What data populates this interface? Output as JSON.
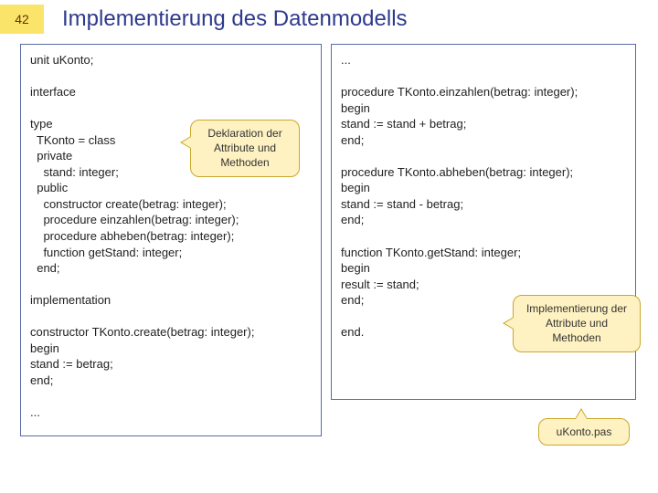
{
  "slide_number": "42",
  "title": "Implementierung des Datenmodells",
  "left_code": [
    "unit uKonto;",
    "",
    "interface",
    "",
    "type",
    "  TKonto = class",
    "  private",
    "    stand: integer;",
    "  public",
    "    constructor create(betrag: integer);",
    "    procedure einzahlen(betrag: integer);",
    "    procedure abheben(betrag: integer);",
    "    function getStand: integer;",
    "  end;",
    "",
    "implementation",
    "",
    "constructor TKonto.create(betrag: integer);",
    "begin",
    "stand := betrag;",
    "end;",
    "",
    "..."
  ],
  "right_code": [
    "...",
    "",
    "procedure TKonto.einzahlen(betrag: integer);",
    "begin",
    "stand := stand + betrag;",
    "end;",
    "",
    "procedure TKonto.abheben(betrag: integer);",
    "begin",
    "stand := stand - betrag;",
    "end;",
    "",
    "function TKonto.getStand: integer;",
    "begin",
    "result := stand;",
    "end;",
    "",
    "end."
  ],
  "callouts": {
    "decl": "Deklaration der Attribute und Methoden",
    "impl": "Implementierung der Attribute und Methoden",
    "file": "uKonto.pas"
  }
}
